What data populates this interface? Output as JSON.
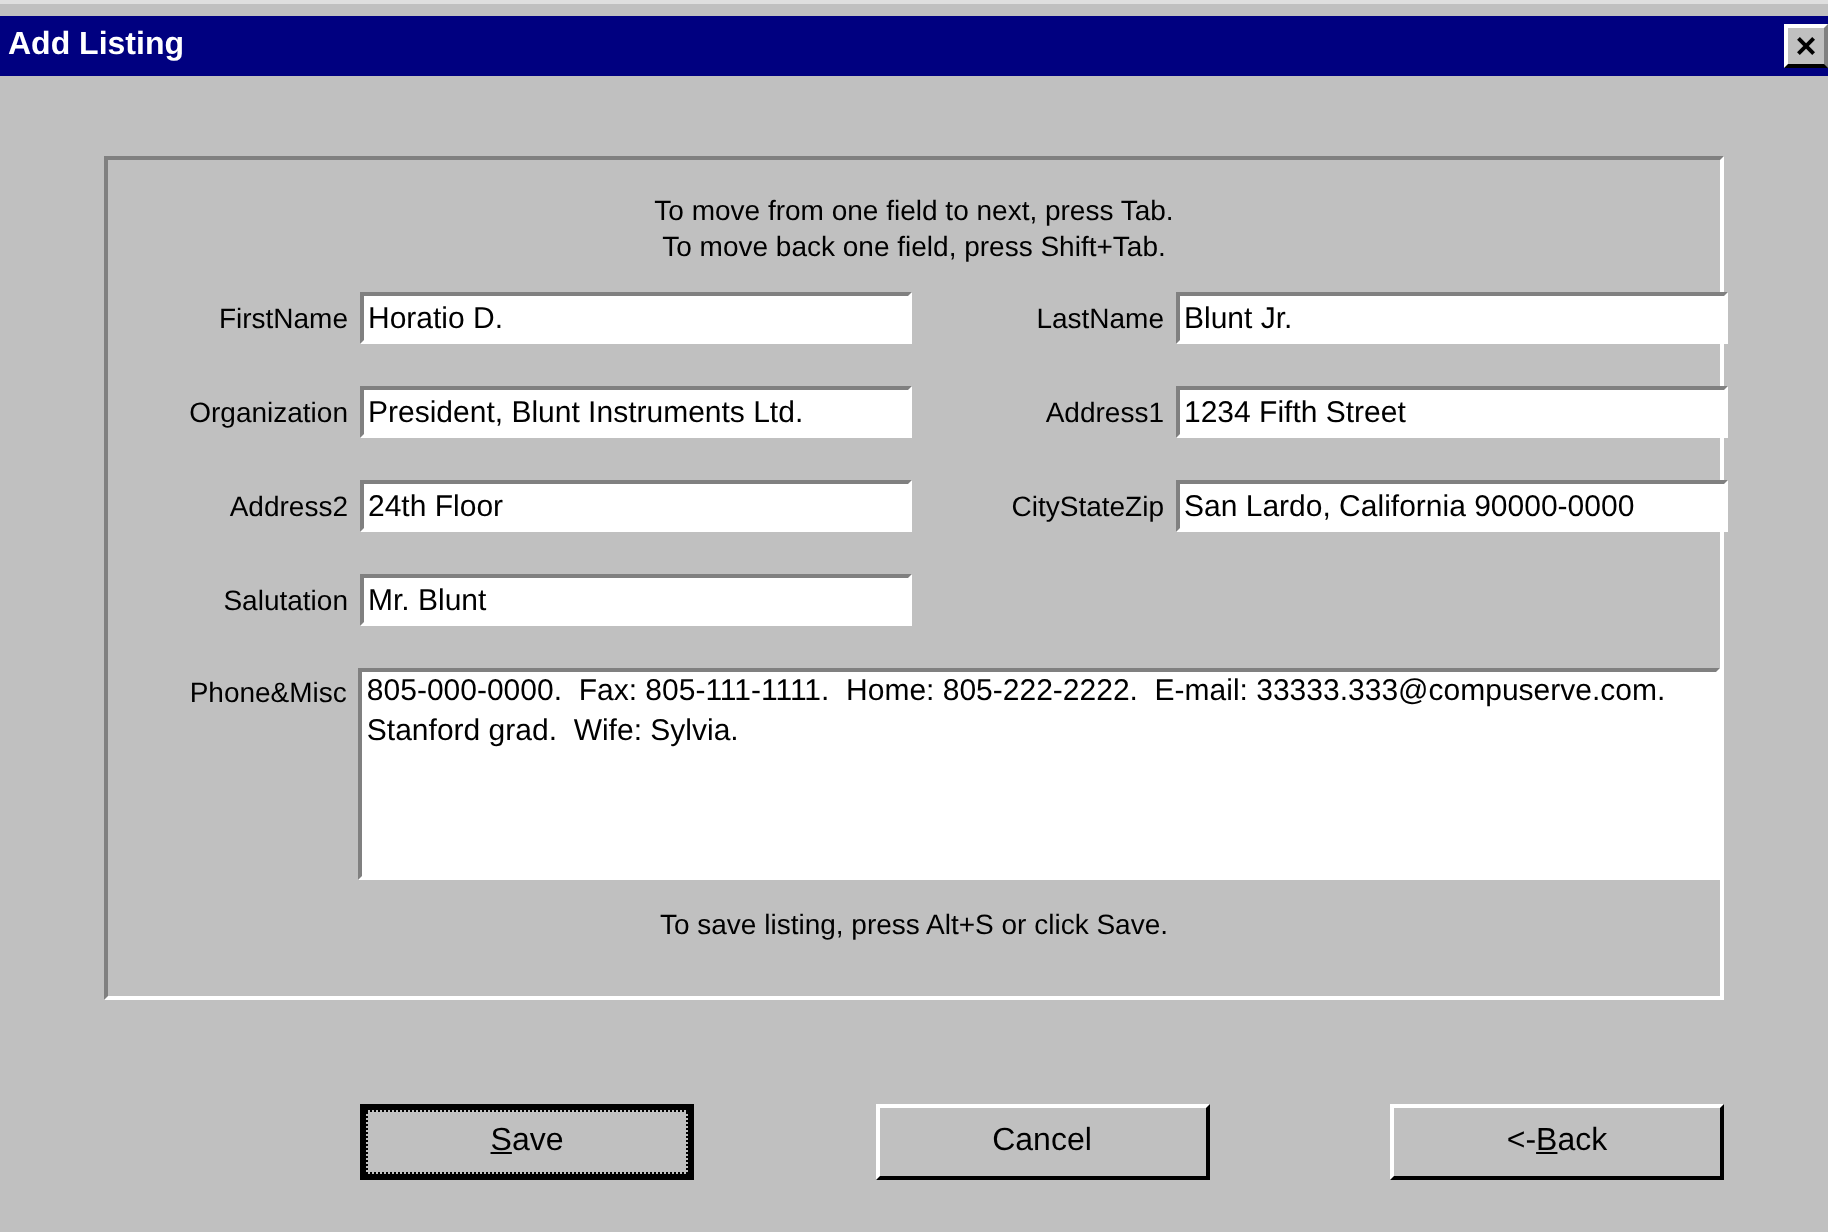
{
  "window": {
    "title": "Add Listing",
    "close": "×"
  },
  "instructions": [
    "To move from one field to next, press Tab.",
    "To move back one field, press Shift+Tab."
  ],
  "fields": [
    {
      "label": "FirstName",
      "value": "Horatio D."
    },
    {
      "label": "LastName",
      "value": "Blunt Jr."
    },
    {
      "label": "Organization",
      "value": "President, Blunt Instruments Ltd."
    },
    {
      "label": "Address1",
      "value": "1234 Fifth Street"
    },
    {
      "label": "Address2",
      "value": "24th Floor"
    },
    {
      "label": "CityStateZip",
      "value": "San Lardo, California 90000-0000"
    },
    {
      "label": "Salutation",
      "value": "Mr. Blunt"
    }
  ],
  "notes": {
    "label": "Phone&Misc",
    "value": "805-000-0000.  Fax: 805-111-1111.  Home: 805-222-2222.  E-mail: 33333.333@compuserve.com.  Stanford grad.  Wife: Sylvia."
  },
  "save_hint": "To save listing, press Alt+S or click Save.",
  "buttons": [
    {
      "key": "S",
      "after": "ave",
      "default": true
    },
    {
      "label": "Cancel",
      "default": false
    },
    {
      "before": "<-",
      "key": "B",
      "after": "ack",
      "default": false
    }
  ]
}
